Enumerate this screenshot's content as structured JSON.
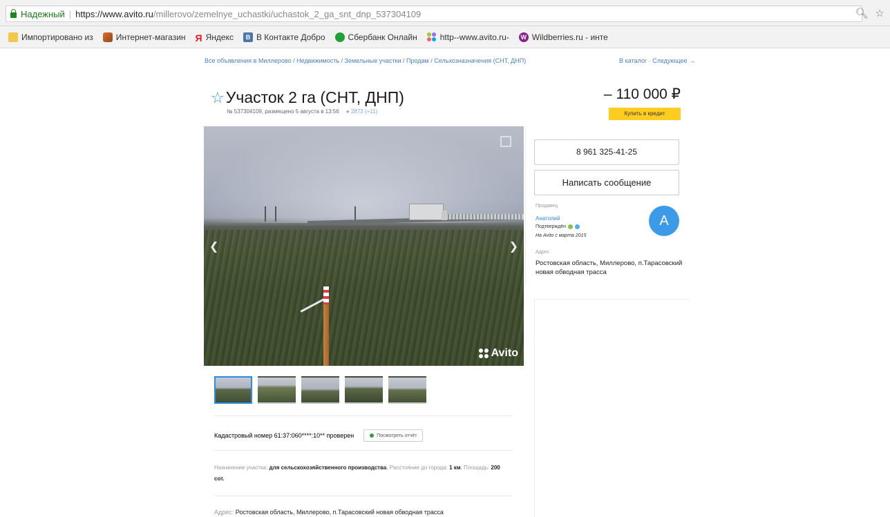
{
  "browser": {
    "secure_label": "Надежный",
    "url_host": "https://www.avito.ru",
    "url_path": "/millerovo/zemelnye_uchastki/uchastok_2_ga_snt_dnp_537304109",
    "bookmarks": [
      {
        "label": "Импортировано из",
        "icon": "folder-icon"
      },
      {
        "label": "Интернет-магазин",
        "icon": "shop-icon"
      },
      {
        "label": "Яндекс",
        "icon": "yandex-icon"
      },
      {
        "label": "В Контакте  Добро",
        "icon": "vk-icon"
      },
      {
        "label": "Сбербанк Онлайн",
        "icon": "sberbank-icon"
      },
      {
        "label": "http--www.avito.ru-",
        "icon": "avito-icon"
      },
      {
        "label": "Wildberries.ru - инте",
        "icon": "wildberries-icon"
      }
    ]
  },
  "breadcrumb": {
    "left": "Все объявления в Миллерово / Недвижимость / Земельные участки / Продам / Сельхозназначения (СНТ, ДНП)",
    "right": "В каталог · Следующее →"
  },
  "listing": {
    "title": "Участок 2 га (СНТ, ДНП)",
    "meta": "№ 537304109, размещено 5 августа в 13:56",
    "views": "2872 (+11)",
    "price": "110 000 ₽",
    "price_prefix": "–",
    "credit_label": "Купить в кредит",
    "cadastral_text": "Кадастровый номер 61:37:060****:10** проверен",
    "report_label": "Посмотреть отчёт",
    "params": {
      "purpose_label": "Назначение участка:",
      "purpose_value": "для сельскохозяйственного производства",
      "distance_label": "Расстояние до города:",
      "distance_value": "1 км",
      "area_label": "Площадь:",
      "area_value": "200 сот."
    },
    "address_label": "Адрес:",
    "address_value": "Ростовская область, Миллерово, п.Тарасовский новая обводная трасса",
    "thumbnails": 5,
    "active_thumbnail": 1,
    "watermark": "Avito"
  },
  "seller": {
    "phone": "8 961 325-41-25",
    "message_label": "Написать сообщение",
    "role_label": "Продавец",
    "name": "Анатолий",
    "verified_label": "Подтверждён",
    "since": "На Avito с марта 2015",
    "avatar_letter": "A",
    "address_label": "Адрес",
    "address_value": "Ростовская область, Миллерово, п.Тарасовский новая обводная трасса"
  },
  "colors": {
    "accent": "#2b8de6",
    "credit_button": "#ffcd1f",
    "secure": "#1a7a1a"
  }
}
